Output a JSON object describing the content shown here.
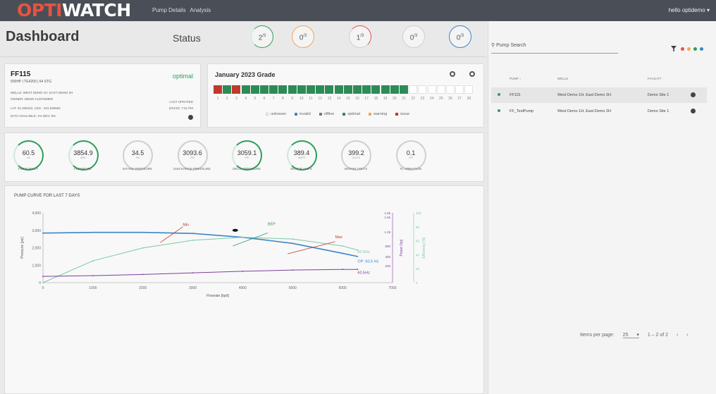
{
  "nav": {
    "logo": "OPTIWATCH",
    "links": [
      "Pump Details",
      "Analysis"
    ],
    "user": "hello optidemo"
  },
  "header": {
    "title": "Dashboard",
    "status_label": "Status",
    "status_counts": [
      {
        "value": "2",
        "total": "/3",
        "color": "#2e9e5b"
      },
      {
        "value": "0",
        "total": "/3",
        "color": "#f2a65a"
      },
      {
        "value": "1",
        "total": "/3",
        "color": "#d9534f"
      },
      {
        "value": "0",
        "total": "/3",
        "color": "#cfcfcf"
      },
      {
        "value": "0",
        "total": "/3",
        "color": "#3a86c8"
      }
    ]
  },
  "pump": {
    "id": "FF115",
    "spec": "500HP | TE4200 | 64 STG",
    "status": "optimal",
    "wells": "wells: West Demo 1H, East Demo 2H",
    "owner": "owner: Demo Customer",
    "latlon": "Lat: 31.209442, Lng: -101.836652",
    "dev": "Data available: 1% DEV: 8%",
    "last_updated_label": "Last updated",
    "last_updated_value": "2/21/23, 7:31 PM"
  },
  "grade": {
    "title": "January 2023 Grade",
    "days": [
      "1",
      "2",
      "3",
      "4",
      "5",
      "6",
      "7",
      "8",
      "9",
      "10",
      "11",
      "12",
      "13",
      "14",
      "15",
      "16",
      "17",
      "18",
      "19",
      "20",
      "21",
      "22",
      "23",
      "24",
      "25",
      "26",
      "27",
      "28"
    ],
    "cells": [
      "#c0392b",
      "#2e8b57",
      "#c0392b",
      "#2e8b57",
      "#2e8b57",
      "#2e8b57",
      "#2e8b57",
      "#2e8b57",
      "#2e8b57",
      "#2e8b57",
      "#2e8b57",
      "#2e8b57",
      "#2e8b57",
      "#2e8b57",
      "#2e8b57",
      "#2e8b57",
      "#2e8b57",
      "#2e8b57",
      "#2e8b57",
      "#2e8b57",
      "#2e8b57",
      "#ffffff",
      "#ffffff",
      "#ffffff",
      "#ffffff",
      "#ffffff",
      "#ffffff",
      "#ffffff"
    ],
    "legend": [
      {
        "label": "unknown",
        "color": "#ffffff"
      },
      {
        "label": "invalid",
        "color": "#3a86c8"
      },
      {
        "label": "offline",
        "color": "#777777"
      },
      {
        "label": "optimal",
        "color": "#2e8b57"
      },
      {
        "label": "warning",
        "color": "#f2a65a"
      },
      {
        "label": "issue",
        "color": "#c0392b"
      }
    ]
  },
  "gauges": [
    {
      "value": "60.5",
      "unit": "Hz",
      "label": "Frequency",
      "active": true
    },
    {
      "value": "3854.9",
      "unit": "bpd",
      "label": "Flowrate",
      "active": true
    },
    {
      "value": "34.5",
      "unit": "psi",
      "label": "Intake Pressure",
      "active": false
    },
    {
      "value": "3093.6",
      "unit": "psi",
      "label": "Discharge Pressure",
      "active": false
    },
    {
      "value": "3059.1",
      "unit": "psi",
      "label": "Delta Pressure",
      "active": true
    },
    {
      "value": "389.4",
      "unit": "amps",
      "label": "Motor Amps",
      "active": true
    },
    {
      "value": "399.2",
      "unit": "volts",
      "label": "Motor Volts",
      "active": false
    },
    {
      "value": "0.1",
      "unit": "ips",
      "label": "TC Vibration",
      "active": false
    }
  ],
  "chart_data": {
    "type": "line",
    "title": "Pump curve for last 7 days",
    "xlabel": "Flowrate [bpd]",
    "ylabel": "Pressure [psi]",
    "y2label": "Power [hp]",
    "y3label": "Efficiency [%]",
    "xlim": [
      0,
      7000
    ],
    "ylim": [
      0,
      4000
    ],
    "y2lim": [
      0,
      1600
    ],
    "y3lim": [
      0,
      100
    ],
    "x_ticks": [
      "0",
      "1000",
      "2000",
      "3000",
      "4000",
      "5000",
      "6000",
      "7000"
    ],
    "y_ticks": [
      "0",
      "1,000",
      "2,000",
      "3,000",
      "4,000"
    ],
    "y2_ticks": [
      "200",
      "400",
      "800",
      "1.2k",
      "1.5k",
      "1.6k"
    ],
    "y3_ticks": [
      "0",
      "20",
      "40",
      "60",
      "80",
      "100"
    ],
    "series": [
      {
        "name": "Head",
        "color": "#3a86c8",
        "x": [
          0,
          1000,
          2000,
          3000,
          4000,
          5000,
          6000,
          6300
        ],
        "y": [
          2840,
          2880,
          2880,
          2820,
          2600,
          2250,
          1680,
          1500
        ]
      },
      {
        "name": "Efficiency",
        "color": "#7ec8a3",
        "x": [
          0,
          1000,
          2000,
          3000,
          4000,
          5000,
          6000,
          6300
        ],
        "y": [
          0,
          1250,
          1990,
          2430,
          2600,
          2500,
          2100,
          1870
        ]
      },
      {
        "name": "Power",
        "color": "#7b3f9e",
        "x": [
          0,
          1000,
          2000,
          3000,
          4000,
          5000,
          6000,
          6300
        ],
        "y": [
          360,
          400,
          470,
          560,
          650,
          720,
          760,
          760
        ]
      }
    ],
    "annotations": [
      {
        "label": "Min",
        "x": 2800,
        "y": 3250,
        "color": "#c0392b"
      },
      {
        "label": "BEP",
        "x": 4500,
        "y": 3300,
        "color": "#2e9e5b"
      },
      {
        "label": "Max",
        "x": 5850,
        "y": 2550,
        "color": "#c0392b"
      },
      {
        "label": "60.5Hz",
        "x": 6300,
        "y": 1700,
        "color": "#7ec8a3"
      },
      {
        "label": "OP: 60.5 Hz",
        "x": 6300,
        "y": 1150,
        "color": "#3a86c8"
      },
      {
        "label": "60.5Hz",
        "x": 6300,
        "y": 500,
        "color": "#7b3f9e"
      }
    ],
    "operating_point": {
      "x": 3850,
      "y": 3000
    }
  },
  "right": {
    "search_placeholder": "Pump Search",
    "filter_dots": [
      "#e8533f",
      "#f2a65a",
      "#2e9e5b",
      "#3a86c8"
    ],
    "columns": [
      "Pump",
      "Wells",
      "Facility"
    ],
    "rows": [
      {
        "pump": "FF115",
        "wells": "West Demo 1H, East Demo 2H",
        "facility": "Demo Site 1",
        "selected": true
      },
      {
        "pump": "FF_TestPump",
        "wells": "West Demo 1H, East Demo 2H",
        "facility": "Demo Site 1",
        "selected": false
      }
    ],
    "items_per_page_label": "Items per page:",
    "items_per_page_value": "25",
    "range": "1 – 2 of 2"
  }
}
